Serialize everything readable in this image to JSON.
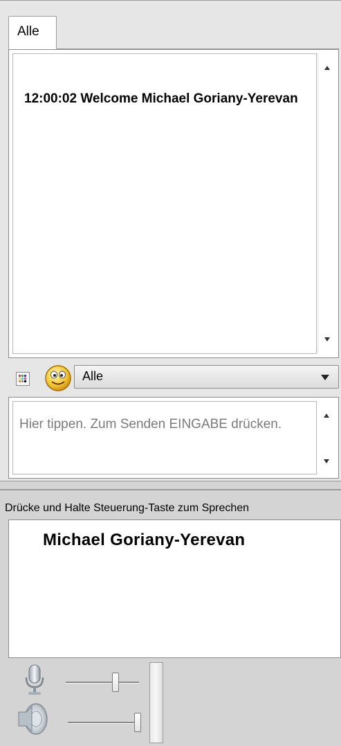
{
  "tabs": [
    {
      "label": "Alle"
    }
  ],
  "chat": {
    "message": "12:00:02 Welcome Michael Goriany-Yerevan"
  },
  "toolbar": {
    "target_selected": "Alle",
    "palette_icon": "color-palette-icon",
    "smiley_icon": "smiley-icon"
  },
  "input": {
    "placeholder": "Hier tippen. Zum Senden EINGABE drücken."
  },
  "voice": {
    "hint": "Drücke und Halte Steuerung-Taste zum Sprechen",
    "speaker": "Michael Goriany-Yerevan",
    "mic_level": 0.7,
    "speaker_level": 1.0,
    "mic_icon": "microphone-icon",
    "speaker_icon": "loudspeaker-icon"
  }
}
